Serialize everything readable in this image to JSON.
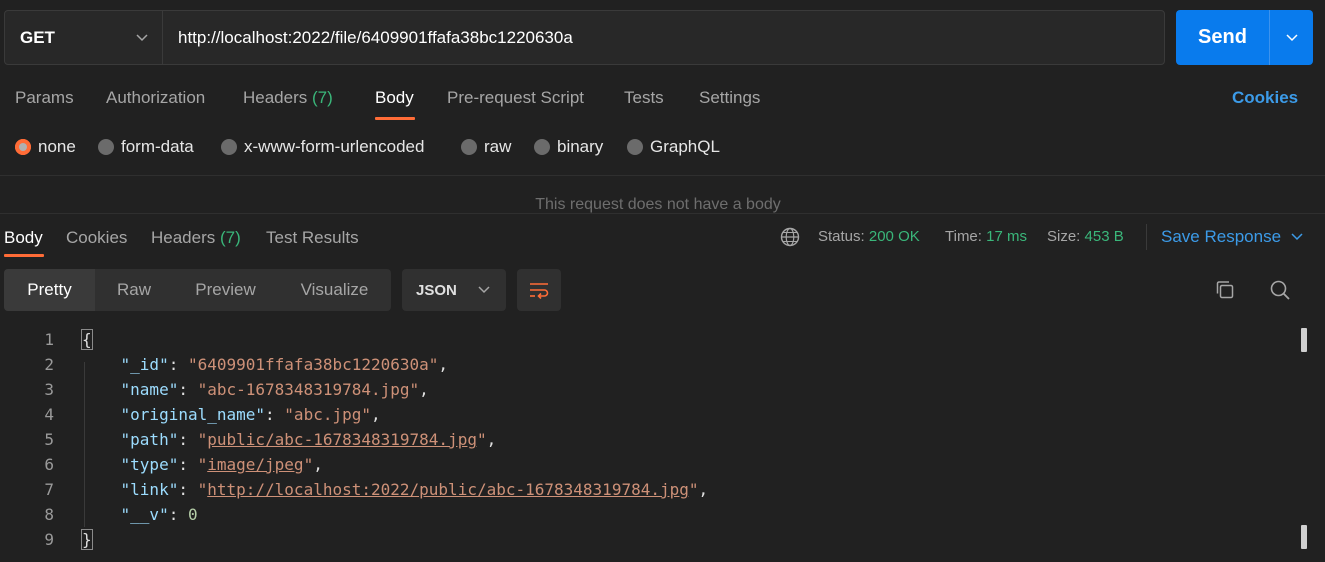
{
  "request": {
    "method": "GET",
    "url": "http://localhost:2022/file/6409901ffafa38bc1220630a",
    "send_label": "Send"
  },
  "request_tabs": {
    "params": "Params",
    "authorization": "Authorization",
    "headers": "Headers",
    "headers_count": "(7)",
    "body": "Body",
    "prerequest": "Pre-request Script",
    "tests": "Tests",
    "settings": "Settings",
    "cookies": "Cookies"
  },
  "body_types": {
    "none": "none",
    "form_data": "form-data",
    "urlencoded": "x-www-form-urlencoded",
    "raw": "raw",
    "binary": "binary",
    "graphql": "GraphQL",
    "selected": "none"
  },
  "no_body_message": "This request does not have a body",
  "response_tabs": {
    "body": "Body",
    "cookies": "Cookies",
    "headers": "Headers",
    "headers_count": "(7)",
    "test_results": "Test Results"
  },
  "response_status": {
    "status_label": "Status:",
    "status_value": "200 OK",
    "time_label": "Time:",
    "time_value": "17 ms",
    "size_label": "Size:",
    "size_value": "453 B",
    "save_response": "Save Response"
  },
  "view_modes": {
    "pretty": "Pretty",
    "raw": "Raw",
    "preview": "Preview",
    "visualize": "Visualize",
    "format": "JSON"
  },
  "code": {
    "line_numbers": [
      "1",
      "2",
      "3",
      "4",
      "5",
      "6",
      "7",
      "8",
      "9"
    ],
    "open_brace": "{",
    "close_brace": "}",
    "fields": [
      {
        "key": "\"_id\"",
        "value": "\"6409901ffafa38bc1220630a\"",
        "sep": ","
      },
      {
        "key": "\"name\"",
        "value": "\"abc-1678348319784.jpg\"",
        "sep": ","
      },
      {
        "key": "\"original_name\"",
        "value": "\"abc.jpg\"",
        "sep": ","
      },
      {
        "key": "\"path\"",
        "value": "public/abc-1678348319784.jpg",
        "sep": ","
      },
      {
        "key": "\"type\"",
        "value": "image/jpeg",
        "sep": ","
      },
      {
        "key": "\"link\"",
        "value": "http://localhost:2022/public/abc-1678348319784.jpg",
        "sep": ","
      },
      {
        "key": "\"__v\"",
        "value": "0",
        "sep": ""
      }
    ]
  },
  "colors": {
    "accent": "#ff6c37",
    "send_button": "#097bed",
    "link": "#3c9be8",
    "status_ok": "#3ab67a"
  }
}
